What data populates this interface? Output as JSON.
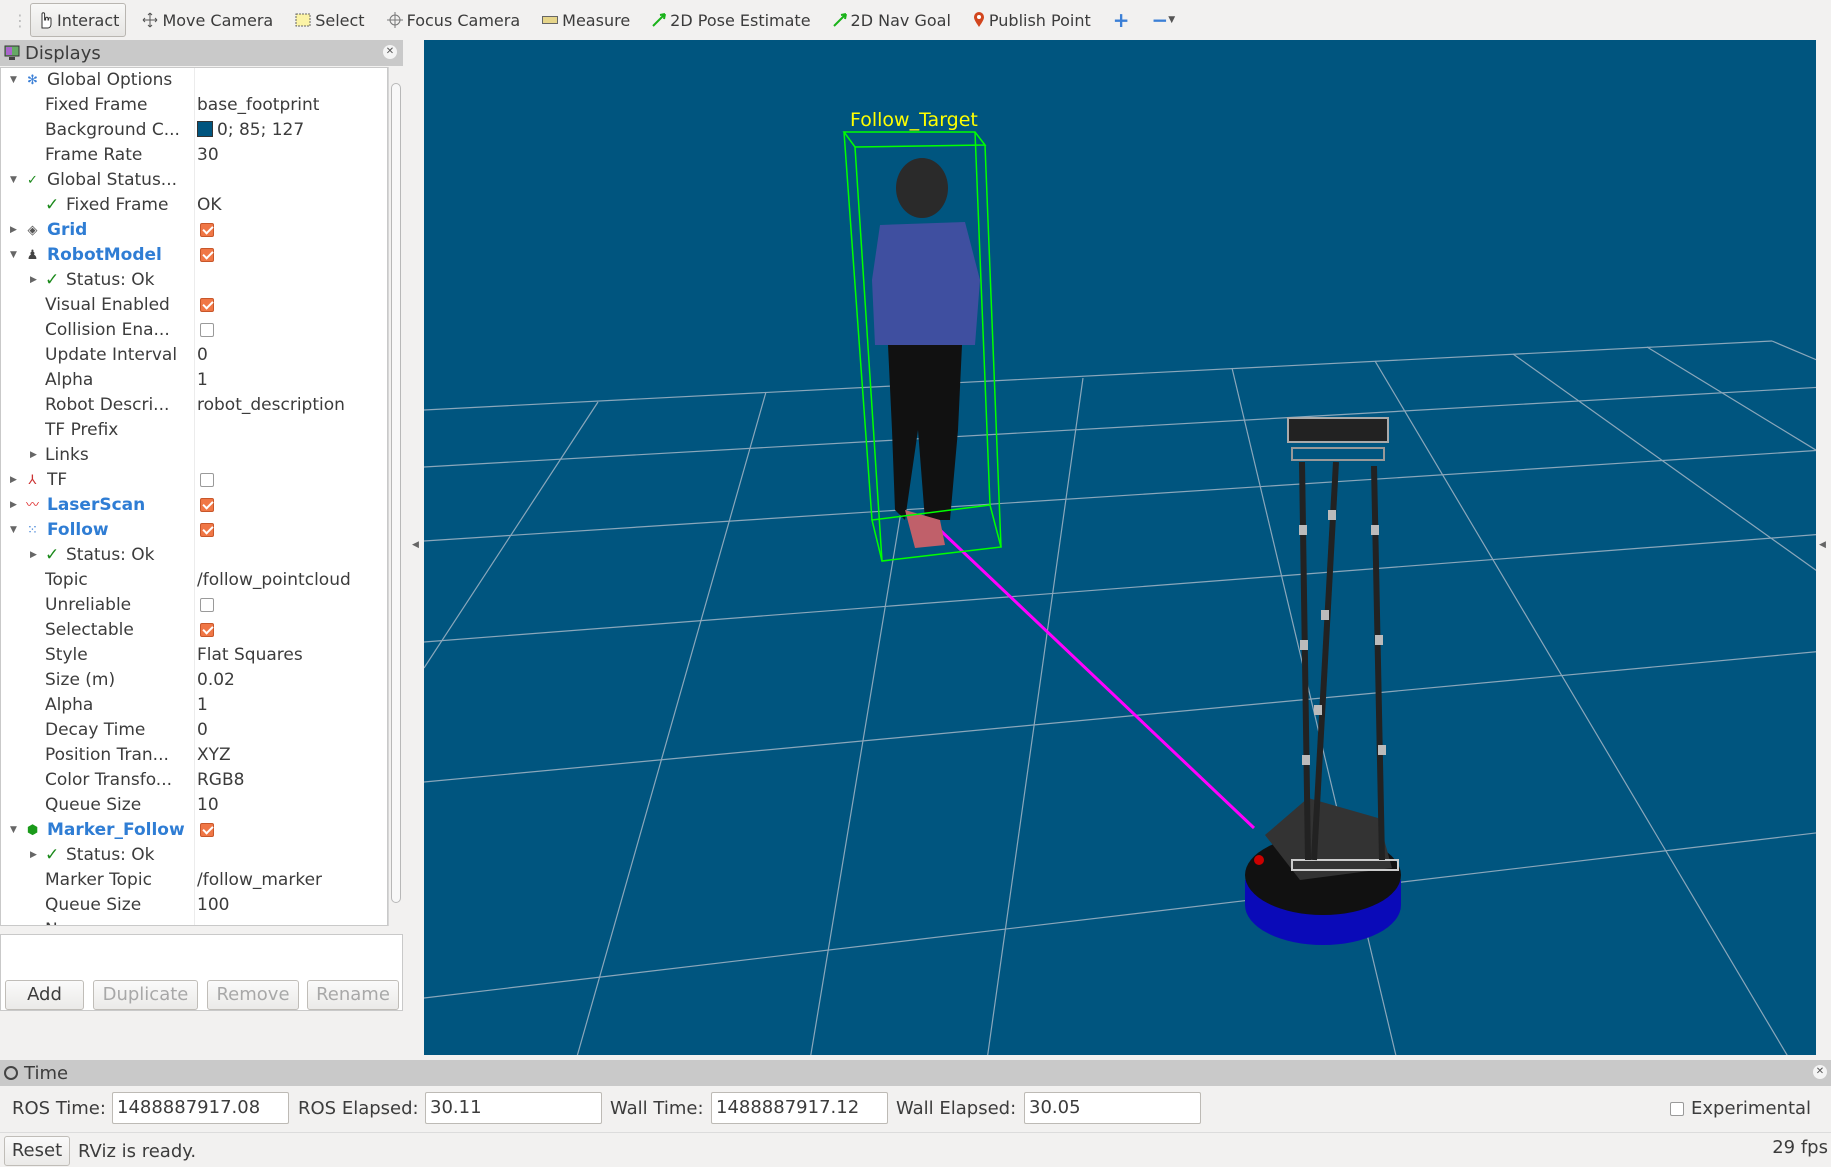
{
  "toolbar": {
    "tools": [
      {
        "label": "Interact",
        "icon": "hand-pointer-icon",
        "active": true
      },
      {
        "label": "Move Camera",
        "icon": "move-camera-icon"
      },
      {
        "label": "Select",
        "icon": "select-box-icon"
      },
      {
        "label": "Focus Camera",
        "icon": "crosshair-icon"
      },
      {
        "label": "Measure",
        "icon": "ruler-icon"
      },
      {
        "label": "2D Pose Estimate",
        "icon": "green-arrow-icon"
      },
      {
        "label": "2D Nav Goal",
        "icon": "green-arrow-icon"
      },
      {
        "label": "Publish Point",
        "icon": "map-pin-icon"
      }
    ],
    "add_icon": "plus-icon",
    "remove_icon": "minus-icon"
  },
  "displays": {
    "title": "Displays",
    "rows": [
      {
        "level": 0,
        "exp": "open",
        "icon": "gear",
        "label": "Global Options"
      },
      {
        "level": 1,
        "label": "Fixed Frame",
        "value": "base_footprint"
      },
      {
        "level": 1,
        "label": "Background C...",
        "value": "0; 85; 127",
        "swatch": "#00557f"
      },
      {
        "level": 1,
        "label": "Frame Rate",
        "value": "30"
      },
      {
        "level": 0,
        "exp": "open",
        "icon": "check",
        "label": "Global Status..."
      },
      {
        "level": 1,
        "check": true,
        "label": "Fixed Frame",
        "value": "OK"
      },
      {
        "level": 0,
        "exp": "closed",
        "icon": "grid",
        "label": "Grid",
        "bold": true,
        "checkbox": true
      },
      {
        "level": 0,
        "exp": "open",
        "icon": "robot",
        "label": "RobotModel",
        "bold": true,
        "checkbox": true
      },
      {
        "level": 1,
        "exp": "closed",
        "check": true,
        "label": "Status: Ok"
      },
      {
        "level": 1,
        "label": "Visual Enabled",
        "checkbox": true
      },
      {
        "level": 1,
        "label": "Collision Ena...",
        "checkbox": false
      },
      {
        "level": 1,
        "label": "Update Interval",
        "value": "0"
      },
      {
        "level": 1,
        "label": "Alpha",
        "value": "1"
      },
      {
        "level": 1,
        "label": "Robot Descri...",
        "value": "robot_description"
      },
      {
        "level": 1,
        "label": "TF Prefix",
        "value": ""
      },
      {
        "level": 1,
        "exp": "closed",
        "label": "Links"
      },
      {
        "level": 0,
        "exp": "closed",
        "icon": "tf",
        "label": "TF",
        "checkbox": false
      },
      {
        "level": 0,
        "exp": "closed",
        "icon": "laser",
        "label": "LaserScan",
        "bold": true,
        "checkbox": true
      },
      {
        "level": 0,
        "exp": "open",
        "icon": "cloud",
        "label": "Follow",
        "bold": true,
        "checkbox": true
      },
      {
        "level": 1,
        "exp": "closed",
        "check": true,
        "label": "Status: Ok"
      },
      {
        "level": 1,
        "label": "Topic",
        "value": "/follow_pointcloud"
      },
      {
        "level": 1,
        "label": "Unreliable",
        "checkbox": false
      },
      {
        "level": 1,
        "label": "Selectable",
        "checkbox": true
      },
      {
        "level": 1,
        "label": "Style",
        "value": "Flat Squares"
      },
      {
        "level": 1,
        "label": "Size (m)",
        "value": "0.02"
      },
      {
        "level": 1,
        "label": "Alpha",
        "value": "1"
      },
      {
        "level": 1,
        "label": "Decay Time",
        "value": "0"
      },
      {
        "level": 1,
        "label": "Position Tran...",
        "value": "XYZ"
      },
      {
        "level": 1,
        "label": "Color Transfo...",
        "value": "RGB8"
      },
      {
        "level": 1,
        "label": "Queue Size",
        "value": "10"
      },
      {
        "level": 0,
        "exp": "open",
        "icon": "marker",
        "label": "Marker_Follow",
        "bold": true,
        "checkbox": true
      },
      {
        "level": 1,
        "exp": "closed",
        "check": true,
        "label": "Status: Ok"
      },
      {
        "level": 1,
        "label": "Marker Topic",
        "value": "/follow_marker"
      },
      {
        "level": 1,
        "label": "Queue Size",
        "value": "100"
      },
      {
        "level": 1,
        "label": "N..."
      }
    ],
    "buttons": {
      "add": "Add",
      "duplicate": "Duplicate",
      "remove": "Remove",
      "rename": "Rename"
    }
  },
  "viewport": {
    "background": "#00557f",
    "marker_label": "Follow_Target",
    "marker_label_color": "#ffff00",
    "bbox_color": "#00ff00",
    "follow_line_color": "#ff00ff"
  },
  "time": {
    "title": "Time",
    "ros_time_label": "ROS Time:",
    "ros_time": "1488887917.08",
    "ros_elapsed_label": "ROS Elapsed:",
    "ros_elapsed": "30.11",
    "wall_time_label": "Wall Time:",
    "wall_time": "1488887917.12",
    "wall_elapsed_label": "Wall Elapsed:",
    "wall_elapsed": "30.05",
    "experimental_label": "Experimental",
    "experimental": false
  },
  "status": {
    "reset": "Reset",
    "message": "RViz is ready.",
    "fps": "29 fps"
  }
}
